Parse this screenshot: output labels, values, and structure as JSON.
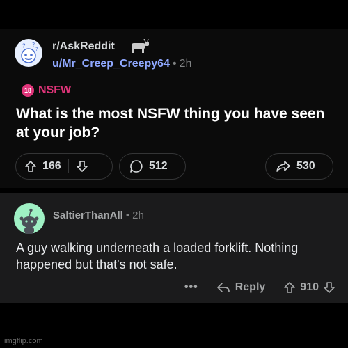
{
  "post": {
    "subreddit": "r/AskReddit",
    "username": "u/Mr_Creep_Creepy64",
    "separator": "•",
    "time": "2h",
    "nsfw_badge": "18",
    "nsfw_label": "NSFW",
    "title": "What is the most NSFW thing you have seen at your job?",
    "upvotes": "166",
    "comments": "512",
    "shares": "530"
  },
  "comment": {
    "username": "SaltierThanAll",
    "separator": "•",
    "time": "2h",
    "body": "A guy walking underneath a loaded forklift. Nothing happened but that's not safe.",
    "more": "•••",
    "reply_label": "Reply",
    "votes": "910"
  },
  "watermark": "imgflip.com",
  "colors": {
    "nsfw": "#e0357a",
    "username": "#8fa8ff",
    "background": "#000000"
  }
}
